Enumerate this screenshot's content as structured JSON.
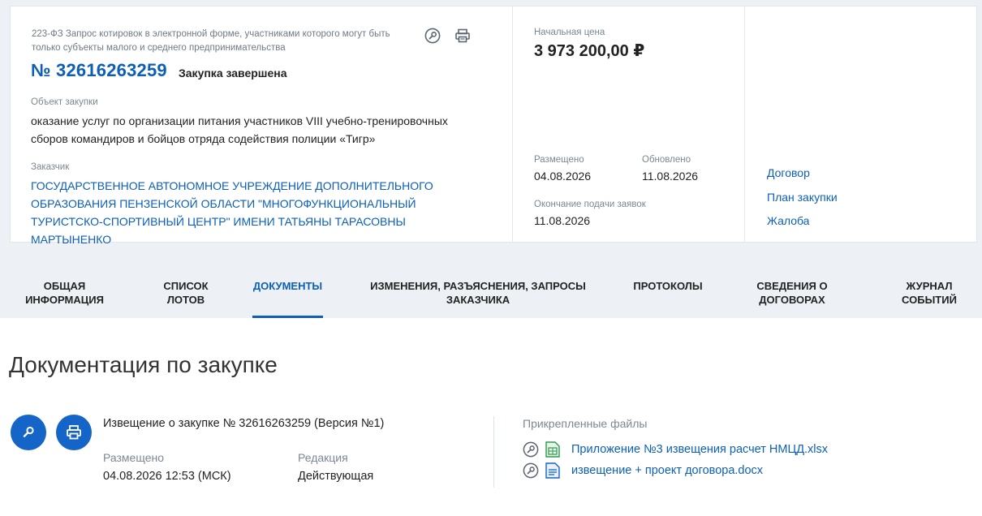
{
  "header": {
    "law_text": "223-ФЗ Запрос котировок в электронной форме, участниками которого могут быть только субъекты малого и среднего предпринимательства",
    "number": "№ 32616263259",
    "status": "Закупка завершена",
    "object_label": "Объект закупки",
    "object_text": "оказание услуг по организации питания участников VIII учебно-тренировочных сборов командиров и бойцов отряда содействия полиции «Тигр»",
    "customer_label": "Заказчик",
    "customer_text": "ГОСУДАРСТВЕННОЕ АВТОНОМНОЕ УЧРЕЖДЕНИЕ ДОПОЛНИТЕЛЬНОГО ОБРАЗОВАНИЯ ПЕНЗЕНСКОЙ ОБЛАСТИ \"МНОГОФУНКЦИОНАЛЬНЫЙ ТУРИСТСКО-СПОРТИВНЫЙ ЦЕНТР\" ИМЕНИ ТАТЬЯНЫ ТАРАСОВНЫ МАРТЫНЕНКО",
    "price_label": "Начальная цена",
    "price": "3 973 200,00 ₽",
    "posted_label": "Размещено",
    "posted": "04.08.2026",
    "updated_label": "Обновлено",
    "updated": "11.08.2026",
    "deadline_label": "Окончание подачи заявок",
    "deadline": "11.08.2026",
    "links": [
      "Договор",
      "План закупки",
      "Жалоба"
    ],
    "icons": {
      "search": "search-icon",
      "print": "print-icon"
    }
  },
  "tabs": [
    {
      "label": "ОБЩАЯ ИНФОРМАЦИЯ",
      "active": false
    },
    {
      "label": "СПИСОК ЛОТОВ",
      "active": false
    },
    {
      "label": "ДОКУМЕНТЫ",
      "active": true
    },
    {
      "label": "ИЗМЕНЕНИЯ, РАЗЪЯСНЕНИЯ, ЗАПРОСЫ ЗАКАЗЧИКА",
      "active": false
    },
    {
      "label": "ПРОТОКОЛЫ",
      "active": false
    },
    {
      "label": "СВЕДЕНИЯ О ДОГОВОРАХ",
      "active": false
    },
    {
      "label": "ЖУРНАЛ СОБЫТИЙ",
      "active": false
    }
  ],
  "docs": {
    "section_title": "Документация по закупке",
    "notice_title": "Извещение о закупке № 32616263259 (Версия №1)",
    "posted_label": "Размещено",
    "posted": "04.08.2026 12:53 (МСК)",
    "edition_label": "Редакция",
    "edition": "Действующая",
    "files_label": "Прикрепленные файлы",
    "files": [
      {
        "name": "Приложение №3 извещения расчет НМЦД.xlsx",
        "type": "xlsx-file-icon"
      },
      {
        "name": "извещение + проект договора.docx",
        "type": "docx-file-icon"
      }
    ]
  },
  "colors": {
    "accent": "#0d5fb5",
    "button": "#1565c8",
    "band": "#edf1f5"
  }
}
